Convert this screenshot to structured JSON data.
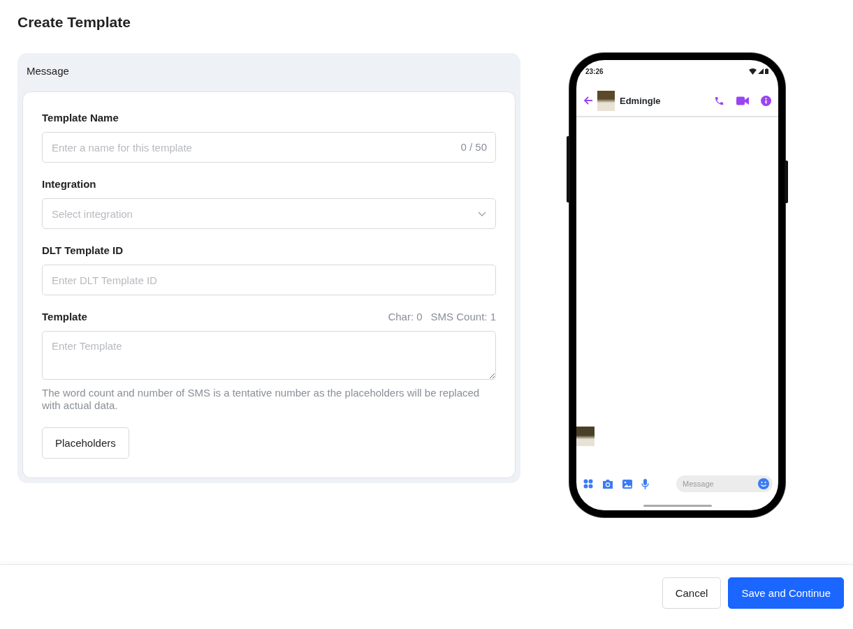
{
  "title": "Create Template",
  "message_card": {
    "title": "Message",
    "fields": [
      {
        "kind": "text",
        "label": "Template Name",
        "placeholder": "Enter a name for this template",
        "counter": "0 / 50"
      },
      {
        "kind": "select",
        "label": "Integration",
        "placeholder": "Select integration"
      },
      {
        "kind": "text",
        "label": "DLT Template ID",
        "placeholder": "Enter DLT Template ID"
      },
      {
        "kind": "textarea",
        "label": "Template",
        "meta": [
          "Char: 0",
          "SMS Count: 1"
        ],
        "placeholder": "Enter Template",
        "help": "The word count and number of SMS is a tentative number as the placeholders will be replaced with actual data."
      }
    ],
    "placeholders_button": "Placeholders"
  },
  "phone_preview": {
    "time": "23:26",
    "contact": "Edmingle",
    "message_placeholder": "Message"
  },
  "footer": {
    "buttons": [
      {
        "label": "Cancel",
        "kind": "secondary"
      },
      {
        "label": "Save and Continue",
        "kind": "primary"
      }
    ]
  }
}
